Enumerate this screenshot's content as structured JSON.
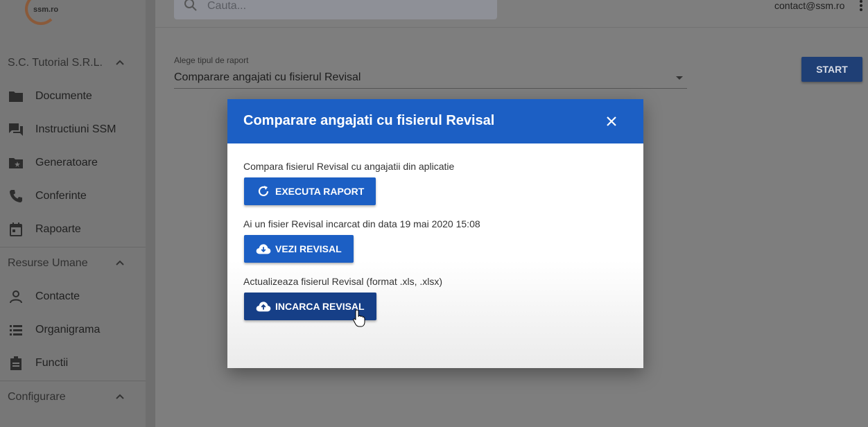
{
  "logo": {
    "text": "ssm.ro"
  },
  "sidebar": {
    "company": {
      "label": "S.C. Tutorial S.R.L."
    },
    "company_items": [
      {
        "label": "Documente",
        "icon": "folder-icon"
      },
      {
        "label": "Instructiuni SSM",
        "icon": "chat-icon"
      },
      {
        "label": "Generatoare",
        "icon": "folder-star-icon"
      },
      {
        "label": "Conferinte",
        "icon": "phone-icon"
      },
      {
        "label": "Rapoarte",
        "icon": "calendar-icon"
      }
    ],
    "hr_section": {
      "label": "Resurse Umane"
    },
    "hr_items": [
      {
        "label": "Contacte",
        "icon": "person-icon"
      },
      {
        "label": "Organigrama",
        "icon": "list-icon"
      },
      {
        "label": "Functii",
        "icon": "clipboard-icon"
      }
    ],
    "config_section": {
      "label": "Configurare"
    }
  },
  "topbar": {
    "search_placeholder": "Cauta...",
    "user_email": "contact@ssm.ro"
  },
  "main": {
    "report_type_label": "Alege tipul de raport",
    "report_type_value": "Comparare angajati cu fisierul Revisal",
    "start_label": "START"
  },
  "dialog": {
    "title": "Comparare angajati cu fisierul Revisal",
    "compare_text": "Compara fisierul Revisal cu angajatii din aplicatie",
    "run_label": "EXECUTA RAPORT",
    "uploaded_text": "Ai un fisier Revisal incarcat din data 19 mai 2020 15:08",
    "view_label": "VEZI REVISAL",
    "update_text": "Actualizeaza fisierul Revisal (format .xls, .xlsx)",
    "upload_label": "INCARCA REVISAL"
  },
  "colors": {
    "dialog_header": "#1c5fc4",
    "button_primary": "#1c5fc4",
    "button_hover": "#163f87",
    "start_button": "#1f3f75"
  }
}
